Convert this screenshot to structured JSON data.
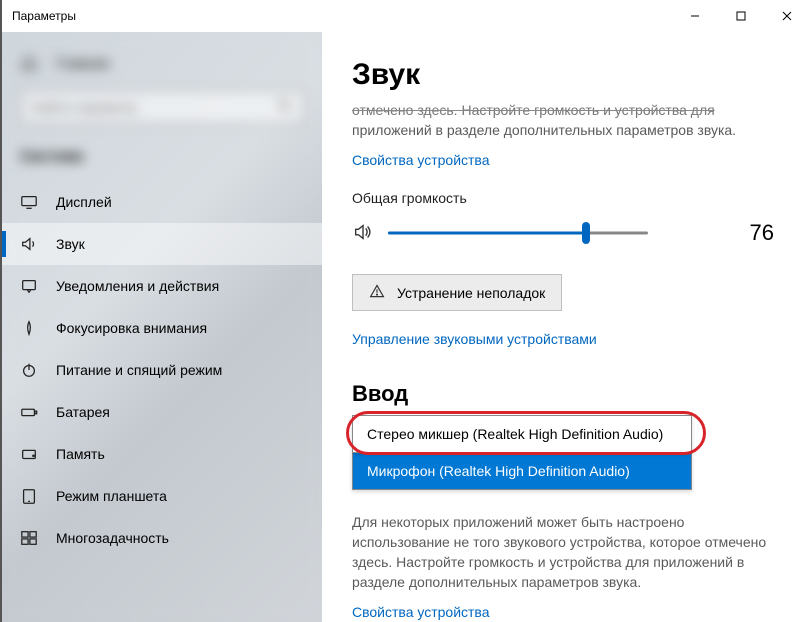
{
  "window": {
    "title": "Параметры"
  },
  "sidebar": {
    "home_label": "Главная",
    "search_placeholder": "Найти параметр",
    "section": "Система",
    "items": [
      {
        "label": "Дисплей"
      },
      {
        "label": "Звук"
      },
      {
        "label": "Уведомления и действия"
      },
      {
        "label": "Фокусировка внимания"
      },
      {
        "label": "Питание и спящий режим"
      },
      {
        "label": "Батарея"
      },
      {
        "label": "Память"
      },
      {
        "label": "Режим планшета"
      },
      {
        "label": "Многозадачность"
      }
    ]
  },
  "main": {
    "heading": "Звук",
    "truncated_a": "отмечено здесь. Настройте громкость и устройства для",
    "truncated_b": "приложений в разделе дополнительных параметров звука.",
    "device_props_link": "Свойства устройства",
    "volume_label": "Общая громкость",
    "volume_value": "76",
    "volume_percent": 76,
    "troubleshoot_label": "Устранение неполадок",
    "manage_devices_link": "Управление звуковыми устройствами",
    "input_heading": "Ввод",
    "input_options": [
      "Стерео микшер (Realtek High Definition Audio)",
      "Микрофон (Realtek High Definition Audio)"
    ],
    "desc": "Для некоторых приложений может быть настроено использование не того звукового устройства, которое отмечено здесь. Настройте громкость и устройства для приложений в разделе дополнительных параметров звука.",
    "device_props_link2": "Свойства устройства"
  }
}
